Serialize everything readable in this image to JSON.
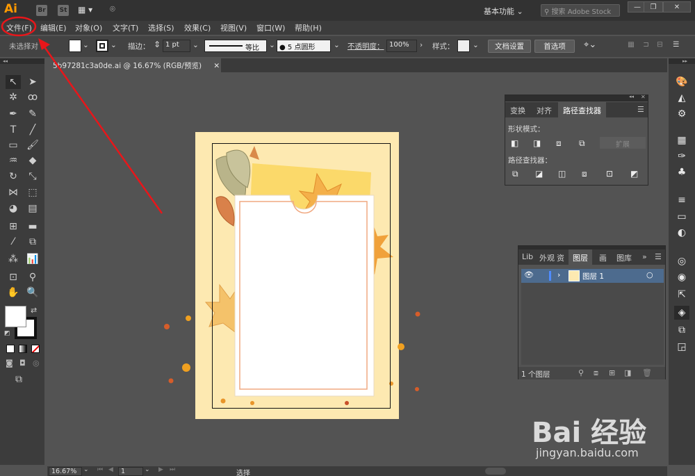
{
  "app": {
    "logo": "Ai",
    "bridge": "Br",
    "stock_launcher": "St",
    "workspace": "基本功能",
    "search_placeholder": "搜索 Adobe Stock"
  },
  "window": {
    "minimize": "—",
    "restore": "❐",
    "close": "✕"
  },
  "menu": {
    "items": [
      "文件(F)",
      "编辑(E)",
      "对象(O)",
      "文字(T)",
      "选择(S)",
      "效果(C)",
      "视图(V)",
      "窗口(W)",
      "帮助(H)"
    ]
  },
  "control_bar": {
    "selection": "未选择对",
    "stroke_label": "描边：",
    "stroke_weight": "1 pt",
    "stroke_profile": "等比",
    "brush": "5 点圆形",
    "opacity_label": "不透明度：",
    "opacity_value": "100%",
    "style_label": "样式：",
    "doc_setup": "文档设置",
    "preferences": "首选项"
  },
  "document": {
    "tab_title": "5b97281c3a0de.ai @ 16.67% (RGB/预览)",
    "close": "✕"
  },
  "pathfinder_panel": {
    "tabs": [
      "变换",
      "对齐",
      "路径查找器"
    ],
    "shape_modes_label": "形状模式：",
    "expand_button": "扩展",
    "pathfinders_label": "路径查找器："
  },
  "layers_panel": {
    "tabs": [
      "Lib",
      "外观",
      "资",
      "图层",
      "画",
      "图库"
    ],
    "active_tab": "图层",
    "layer_name": "图层 1",
    "footer_count": "1 个图层"
  },
  "status_bar": {
    "zoom": "16.67%",
    "page": "1",
    "tool_status": "选择"
  },
  "watermark": {
    "brand": "Bai 经验",
    "url": "jingyan.baidu.com"
  },
  "colors": {
    "accent_orange": "#ff9a00",
    "annotation_red": "#e8161a",
    "artboard_bg": "#fde9b1",
    "layer_highlight": "#4d6b8e"
  }
}
